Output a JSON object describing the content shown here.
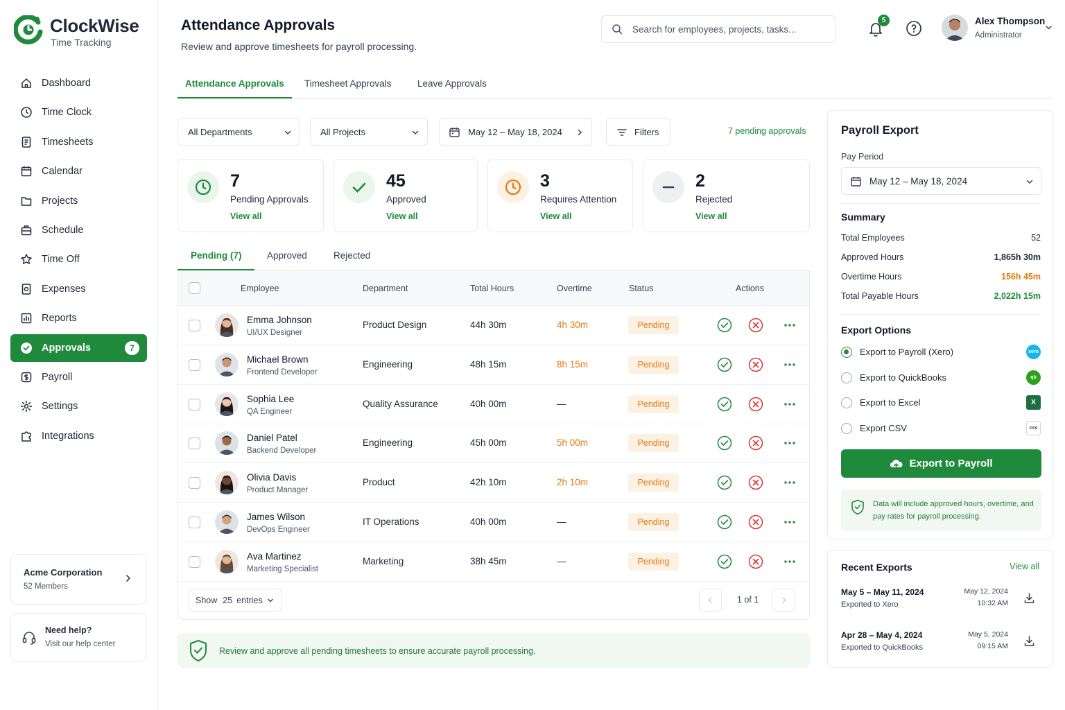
{
  "brand": {
    "name": "ClockWise",
    "subtitle": "Time Tracking",
    "color": "#1f8a3b"
  },
  "nav": [
    {
      "label": "Dashboard",
      "icon": "home-icon"
    },
    {
      "label": "Time Clock",
      "icon": "clock-icon"
    },
    {
      "label": "Timesheets",
      "icon": "document-icon"
    },
    {
      "label": "Calendar",
      "icon": "calendar-icon"
    },
    {
      "label": "Projects",
      "icon": "folder-icon"
    },
    {
      "label": "Schedule",
      "icon": "briefcase-icon"
    },
    {
      "label": "Time Off",
      "icon": "star-icon"
    },
    {
      "label": "Expenses",
      "icon": "receipt-icon"
    },
    {
      "label": "Reports",
      "icon": "reports-icon"
    },
    {
      "label": "Approvals",
      "icon": "check-circle-icon",
      "badge": "7",
      "active": true
    },
    {
      "label": "Payroll",
      "icon": "dollar-icon"
    },
    {
      "label": "Settings",
      "icon": "gear-icon"
    },
    {
      "label": "Integrations",
      "icon": "puzzle-icon"
    }
  ],
  "org": {
    "name": "Acme Corporation",
    "members": "52 Members"
  },
  "help": {
    "title": "Need help?",
    "subtitle": "Visit our help center"
  },
  "header": {
    "title": "Attendance Approvals",
    "subtitle": "Review and approve timesheets for payroll processing.",
    "search_placeholder": "Search for employees, projects, tasks...",
    "notification_count": "5",
    "user_name": "Alex Thompson",
    "user_role": "Administrator"
  },
  "tabs": [
    "Attendance Approvals",
    "Timesheet Approvals",
    "Leave Approvals"
  ],
  "filters": {
    "department": "All Departments",
    "project": "All Projects",
    "date_range": "May 12 – May 18, 2024",
    "filters_label": "Filters",
    "pending_link": "7 pending approvals"
  },
  "stats": [
    {
      "value": "7",
      "label": "Pending Approvals",
      "link": "View all",
      "icon": "clock-icon",
      "color": "#1f8a3b"
    },
    {
      "value": "45",
      "label": "Approved",
      "link": "View all",
      "icon": "check-icon",
      "color": "#1f8a3b"
    },
    {
      "value": "3",
      "label": "Requires Attention",
      "link": "View all",
      "icon": "clock-icon",
      "color": "#e07b12"
    },
    {
      "value": "2",
      "label": "Rejected",
      "link": "View all",
      "icon": "minus-icon",
      "color": "#374151"
    }
  ],
  "subtabs": [
    "Pending (7)",
    "Approved",
    "Rejected"
  ],
  "table": {
    "columns": [
      "Employee",
      "Department",
      "Total Hours",
      "Overtime",
      "Status",
      "Actions"
    ],
    "rows": [
      {
        "name": "Emma Johnson",
        "role": "UI/UX Designer",
        "department": "Product Design",
        "hours": "44h 30m",
        "overtime": "4h 30m",
        "status": "Pending"
      },
      {
        "name": "Michael Brown",
        "role": "Frontend Developer",
        "department": "Engineering",
        "hours": "48h 15m",
        "overtime": "8h 15m",
        "status": "Pending"
      },
      {
        "name": "Sophia Lee",
        "role": "QA Engineer",
        "department": "Quality Assurance",
        "hours": "40h 00m",
        "overtime": "—",
        "status": "Pending"
      },
      {
        "name": "Daniel Patel",
        "role": "Backend Developer",
        "department": "Engineering",
        "hours": "45h 00m",
        "overtime": "5h 00m",
        "status": "Pending"
      },
      {
        "name": "Olivia Davis",
        "role": "Product Manager",
        "department": "Product",
        "hours": "42h 10m",
        "overtime": "2h 10m",
        "status": "Pending"
      },
      {
        "name": "James Wilson",
        "role": "DevOps Engineer",
        "department": "IT Operations",
        "hours": "40h 00m",
        "overtime": "—",
        "status": "Pending"
      },
      {
        "name": "Ava Martinez",
        "role": "Marketing Specialist",
        "department": "Marketing",
        "hours": "38h 45m",
        "overtime": "—",
        "status": "Pending"
      }
    ],
    "show_label": "Show",
    "show_value": "25",
    "entries_label": "entries",
    "pagination": "1 of 1"
  },
  "notice": "Review and approve all pending timesheets to ensure accurate payroll processing.",
  "payroll": {
    "title": "Payroll Export",
    "pay_period_label": "Pay Period",
    "pay_period": "May 12 – May 18, 2024",
    "summary_title": "Summary",
    "summary": [
      {
        "label": "Total Employees",
        "value": "52",
        "color": "#1f2937"
      },
      {
        "label": "Approved Hours",
        "value": "1,865h 30m",
        "color": "#1f2937"
      },
      {
        "label": "Overtime Hours",
        "value": "156h 45m",
        "color": "#e07b12"
      },
      {
        "label": "Total Payable Hours",
        "value": "2,022h 15m",
        "color": "#1f8a3b"
      }
    ],
    "export_title": "Export Options",
    "options": [
      {
        "label": "Export to Payroll (Xero)",
        "selected": true,
        "logo": "xero",
        "logo_color": "#13b5ea"
      },
      {
        "label": "Export to QuickBooks",
        "selected": false,
        "logo": "qb",
        "logo_color": "#2ca01c"
      },
      {
        "label": "Export to Excel",
        "selected": false,
        "logo": "X",
        "logo_color": "#1d6f42"
      },
      {
        "label": "Export CSV",
        "selected": false,
        "logo": "csv",
        "logo_color": "#6b7280"
      }
    ],
    "button": "Export to Payroll",
    "note": "Data will include approved hours, overtime, and pay rates for payroll processing."
  },
  "recent": {
    "title": "Recent Exports",
    "view_all": "View all",
    "items": [
      {
        "period": "May 5 – May 11, 2024",
        "destination": "Exported to Xero",
        "date": "May 12, 2024",
        "time": "10:32 AM"
      },
      {
        "period": "Apr 28 – May 4, 2024",
        "destination": "Exported to QuickBooks",
        "date": "May 5, 2024",
        "time": "09:15 AM"
      }
    ]
  }
}
